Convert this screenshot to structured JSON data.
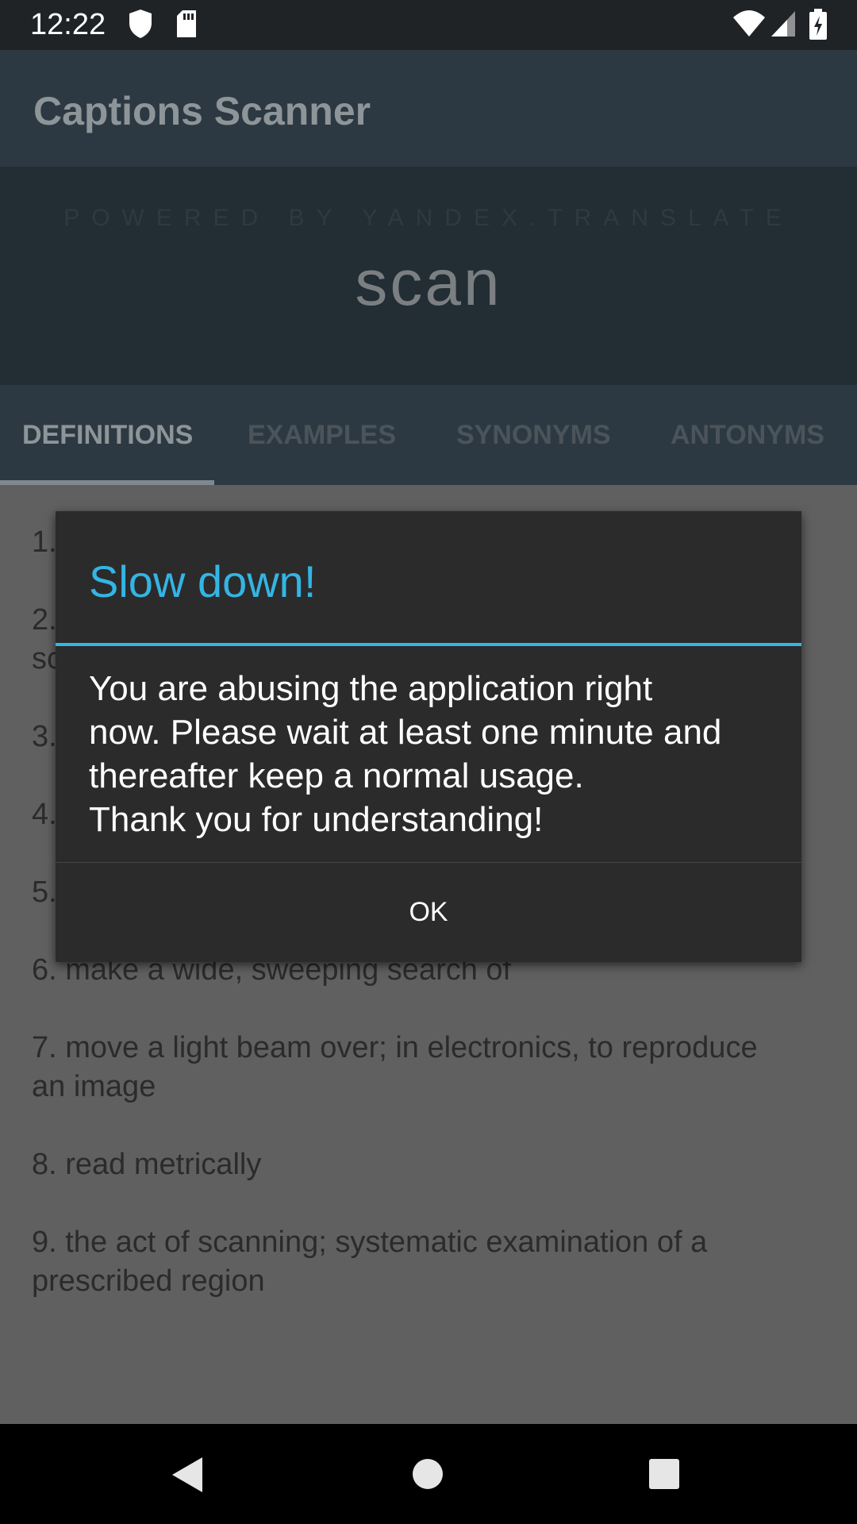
{
  "status_bar": {
    "time": "12:22",
    "icons": [
      "shield-icon",
      "sd-card-icon",
      "wifi-icon",
      "signal-icon",
      "battery-charging-icon"
    ]
  },
  "app_bar": {
    "title": "Captions Scanner"
  },
  "header": {
    "powered_by": "POWERED BY YANDEX.TRANSLATE",
    "word": "scan"
  },
  "tabs": [
    {
      "label": "DEFINITIONS",
      "active": true
    },
    {
      "label": "EXAMPLES",
      "active": false
    },
    {
      "label": "SYNONYMS",
      "active": false
    },
    {
      "label": "ANTONYMS",
      "active": false
    }
  ],
  "definitions_visible": [
    {
      "line1": "1.",
      "line2": ""
    },
    {
      "line1": "2.",
      "line2": "sc"
    },
    {
      "line1": "3.",
      "line2": ""
    },
    {
      "line1": "4.",
      "line2": ""
    },
    {
      "line1": "5.",
      "line2": ""
    },
    {
      "line1": "6. make a wide, sweeping search of",
      "line2": ""
    },
    {
      "line1": "7. move a light beam over; in electronics, to reproduce",
      "line2": "an image"
    },
    {
      "line1": "8. read metrically",
      "line2": ""
    },
    {
      "line1": "9. the act of scanning; systematic examination of a",
      "line2": "prescribed region"
    }
  ],
  "dialog": {
    "title": "Slow down!",
    "message_lines": [
      "You are abusing the application right",
      "now. Please wait at least one minute and",
      "thereafter keep a normal usage.",
      "Thank you for understanding!"
    ],
    "ok_label": "OK",
    "accent_color": "#33b5e5"
  },
  "nav_bar": {
    "buttons": [
      "back-icon",
      "home-icon",
      "recents-icon"
    ]
  }
}
